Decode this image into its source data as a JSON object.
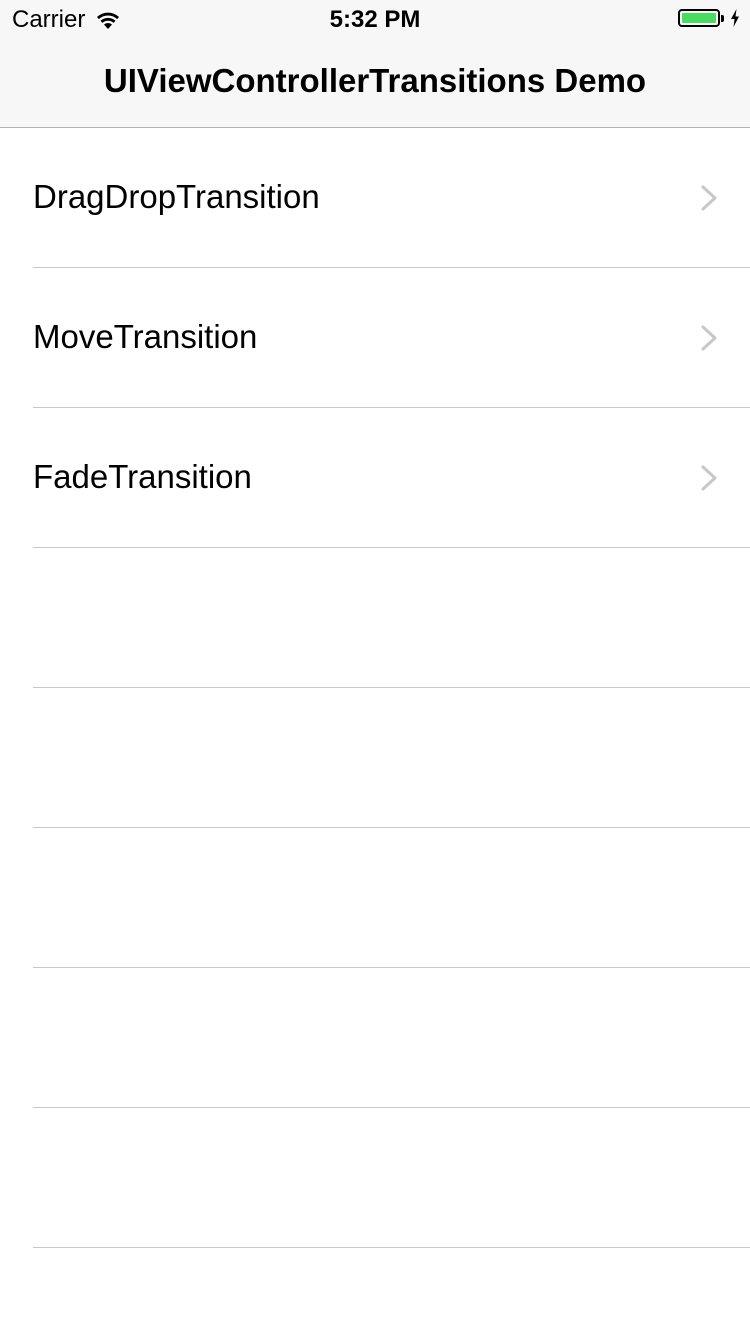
{
  "status_bar": {
    "carrier": "Carrier",
    "time": "5:32 PM",
    "battery_level": 1.0,
    "icons": [
      "wifi-icon",
      "battery-icon",
      "charging-bolt-icon"
    ]
  },
  "nav_bar": {
    "title": "UIViewControllerTransitions Demo"
  },
  "table": {
    "rows": [
      {
        "label": "DragDropTransition",
        "accessory": "chevron-right-icon"
      },
      {
        "label": "MoveTransition",
        "accessory": "chevron-right-icon"
      },
      {
        "label": "FadeTransition",
        "accessory": "chevron-right-icon"
      }
    ],
    "empty_row_count": 5
  },
  "colors": {
    "battery_fill": "#4cd964",
    "nav_background": "#f7f7f7",
    "separator": "#c8c7cc",
    "chevron": "#c7c7cc"
  }
}
